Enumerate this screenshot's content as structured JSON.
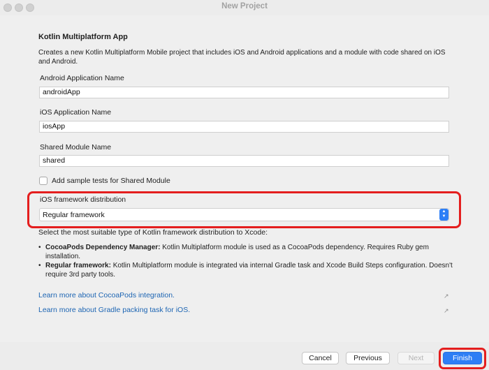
{
  "window": {
    "title": "New Project"
  },
  "form": {
    "heading": "Kotlin Multiplatform App",
    "description": "Creates a new Kotlin Multiplatform Mobile project that includes iOS and Android applications and a module with code shared on iOS and Android.",
    "android_app_name_label": "Android Application Name",
    "android_app_name_value": "androidApp",
    "ios_app_name_label": "iOS Application Name",
    "ios_app_name_value": "iosApp",
    "shared_module_name_label": "Shared Module Name",
    "shared_module_name_value": "shared",
    "sample_tests_label": "Add sample tests for Shared Module",
    "sample_tests_checked": false,
    "ios_distribution_label": "iOS framework distribution",
    "ios_distribution_value": "Regular framework",
    "distribution_hint": "Select the most suitable type of Kotlin framework distribution to Xcode:",
    "bullets": [
      {
        "title": "CocoaPods Dependency Manager:",
        "text": " Kotlin Multiplatform module is used as a CocoaPods dependency. Requires Ruby gem installation."
      },
      {
        "title": "Regular framework:",
        "text": " Kotlin Multiplatform module is integrated via internal Gradle task and Xcode Build Steps configuration. Doesn't require 3rd party tools."
      }
    ],
    "links": [
      {
        "label": "Learn more about CocoaPods integration.",
        "icon": "external-link-icon"
      },
      {
        "label": "Learn more about Gradle packing task for iOS.",
        "icon": "external-link-icon"
      }
    ]
  },
  "footer": {
    "cancel_label": "Cancel",
    "previous_label": "Previous",
    "next_label": "Next",
    "finish_label": "Finish"
  },
  "colors": {
    "accent": "#2e7ef5",
    "highlight": "#e41e1e",
    "link": "#1d65b3"
  }
}
